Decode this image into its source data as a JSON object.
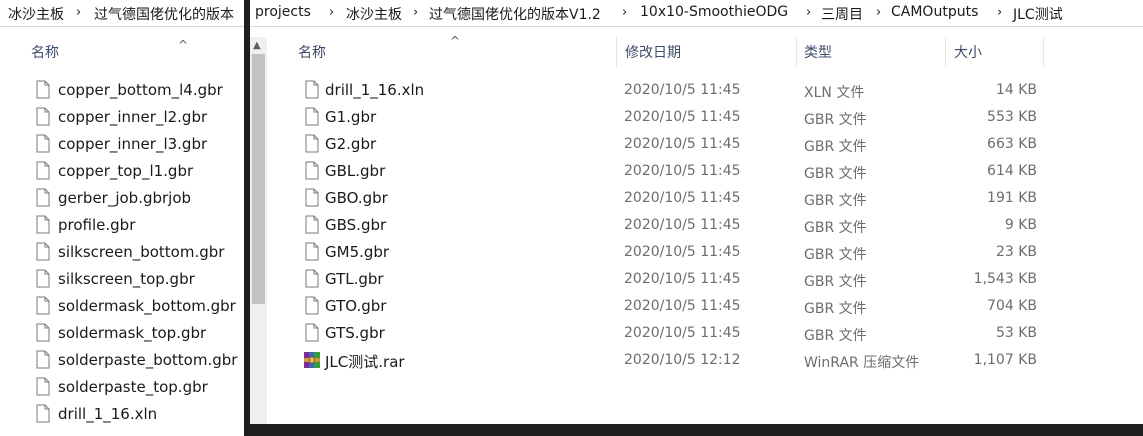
{
  "back_window": {
    "breadcrumb": [
      "冰沙主板",
      "过气德国佬优化的版本"
    ],
    "columns": {
      "name": "名称"
    },
    "files": [
      "copper_bottom_l4.gbr",
      "copper_inner_l2.gbr",
      "copper_inner_l3.gbr",
      "copper_top_l1.gbr",
      "gerber_job.gbrjob",
      "profile.gbr",
      "silkscreen_bottom.gbr",
      "silkscreen_top.gbr",
      "soldermask_bottom.gbr",
      "soldermask_top.gbr",
      "solderpaste_bottom.gbr",
      "solderpaste_top.gbr",
      "drill_1_16.xln"
    ]
  },
  "front_window": {
    "breadcrumb": [
      "projects",
      "冰沙主板",
      "过气德国佬优化的版本V1.2",
      "10x10-SmoothieODG",
      "三周目",
      "CAMOutputs",
      "JLC测试"
    ],
    "columns": {
      "name": "名称",
      "date": "修改日期",
      "type": "类型",
      "size": "大小"
    },
    "files": [
      {
        "name": "drill_1_16.xln",
        "date": "2020/10/5 11:45",
        "type": "XLN 文件",
        "size": "14 KB",
        "icon": "document-icon"
      },
      {
        "name": "G1.gbr",
        "date": "2020/10/5 11:45",
        "type": "GBR 文件",
        "size": "553 KB",
        "icon": "document-icon"
      },
      {
        "name": "G2.gbr",
        "date": "2020/10/5 11:45",
        "type": "GBR 文件",
        "size": "663 KB",
        "icon": "document-icon"
      },
      {
        "name": "GBL.gbr",
        "date": "2020/10/5 11:45",
        "type": "GBR 文件",
        "size": "614 KB",
        "icon": "document-icon"
      },
      {
        "name": "GBO.gbr",
        "date": "2020/10/5 11:45",
        "type": "GBR 文件",
        "size": "191 KB",
        "icon": "document-icon"
      },
      {
        "name": "GBS.gbr",
        "date": "2020/10/5 11:45",
        "type": "GBR 文件",
        "size": "9 KB",
        "icon": "document-icon"
      },
      {
        "name": "GM5.gbr",
        "date": "2020/10/5 11:45",
        "type": "GBR 文件",
        "size": "23 KB",
        "icon": "document-icon"
      },
      {
        "name": "GTL.gbr",
        "date": "2020/10/5 11:45",
        "type": "GBR 文件",
        "size": "1,543 KB",
        "icon": "document-icon"
      },
      {
        "name": "GTO.gbr",
        "date": "2020/10/5 11:45",
        "type": "GBR 文件",
        "size": "704 KB",
        "icon": "document-icon"
      },
      {
        "name": "GTS.gbr",
        "date": "2020/10/5 11:45",
        "type": "GBR 文件",
        "size": "53 KB",
        "icon": "document-icon"
      },
      {
        "name": "JLC测试.rar",
        "date": "2020/10/5 12:12",
        "type": "WinRAR 压缩文件",
        "size": "1,107 KB",
        "icon": "winrar-archive-icon"
      }
    ]
  },
  "colors": {
    "header_text": "#3c4b6b",
    "detail_text": "#6d6d6d",
    "window_border": "#1e1e1e"
  }
}
